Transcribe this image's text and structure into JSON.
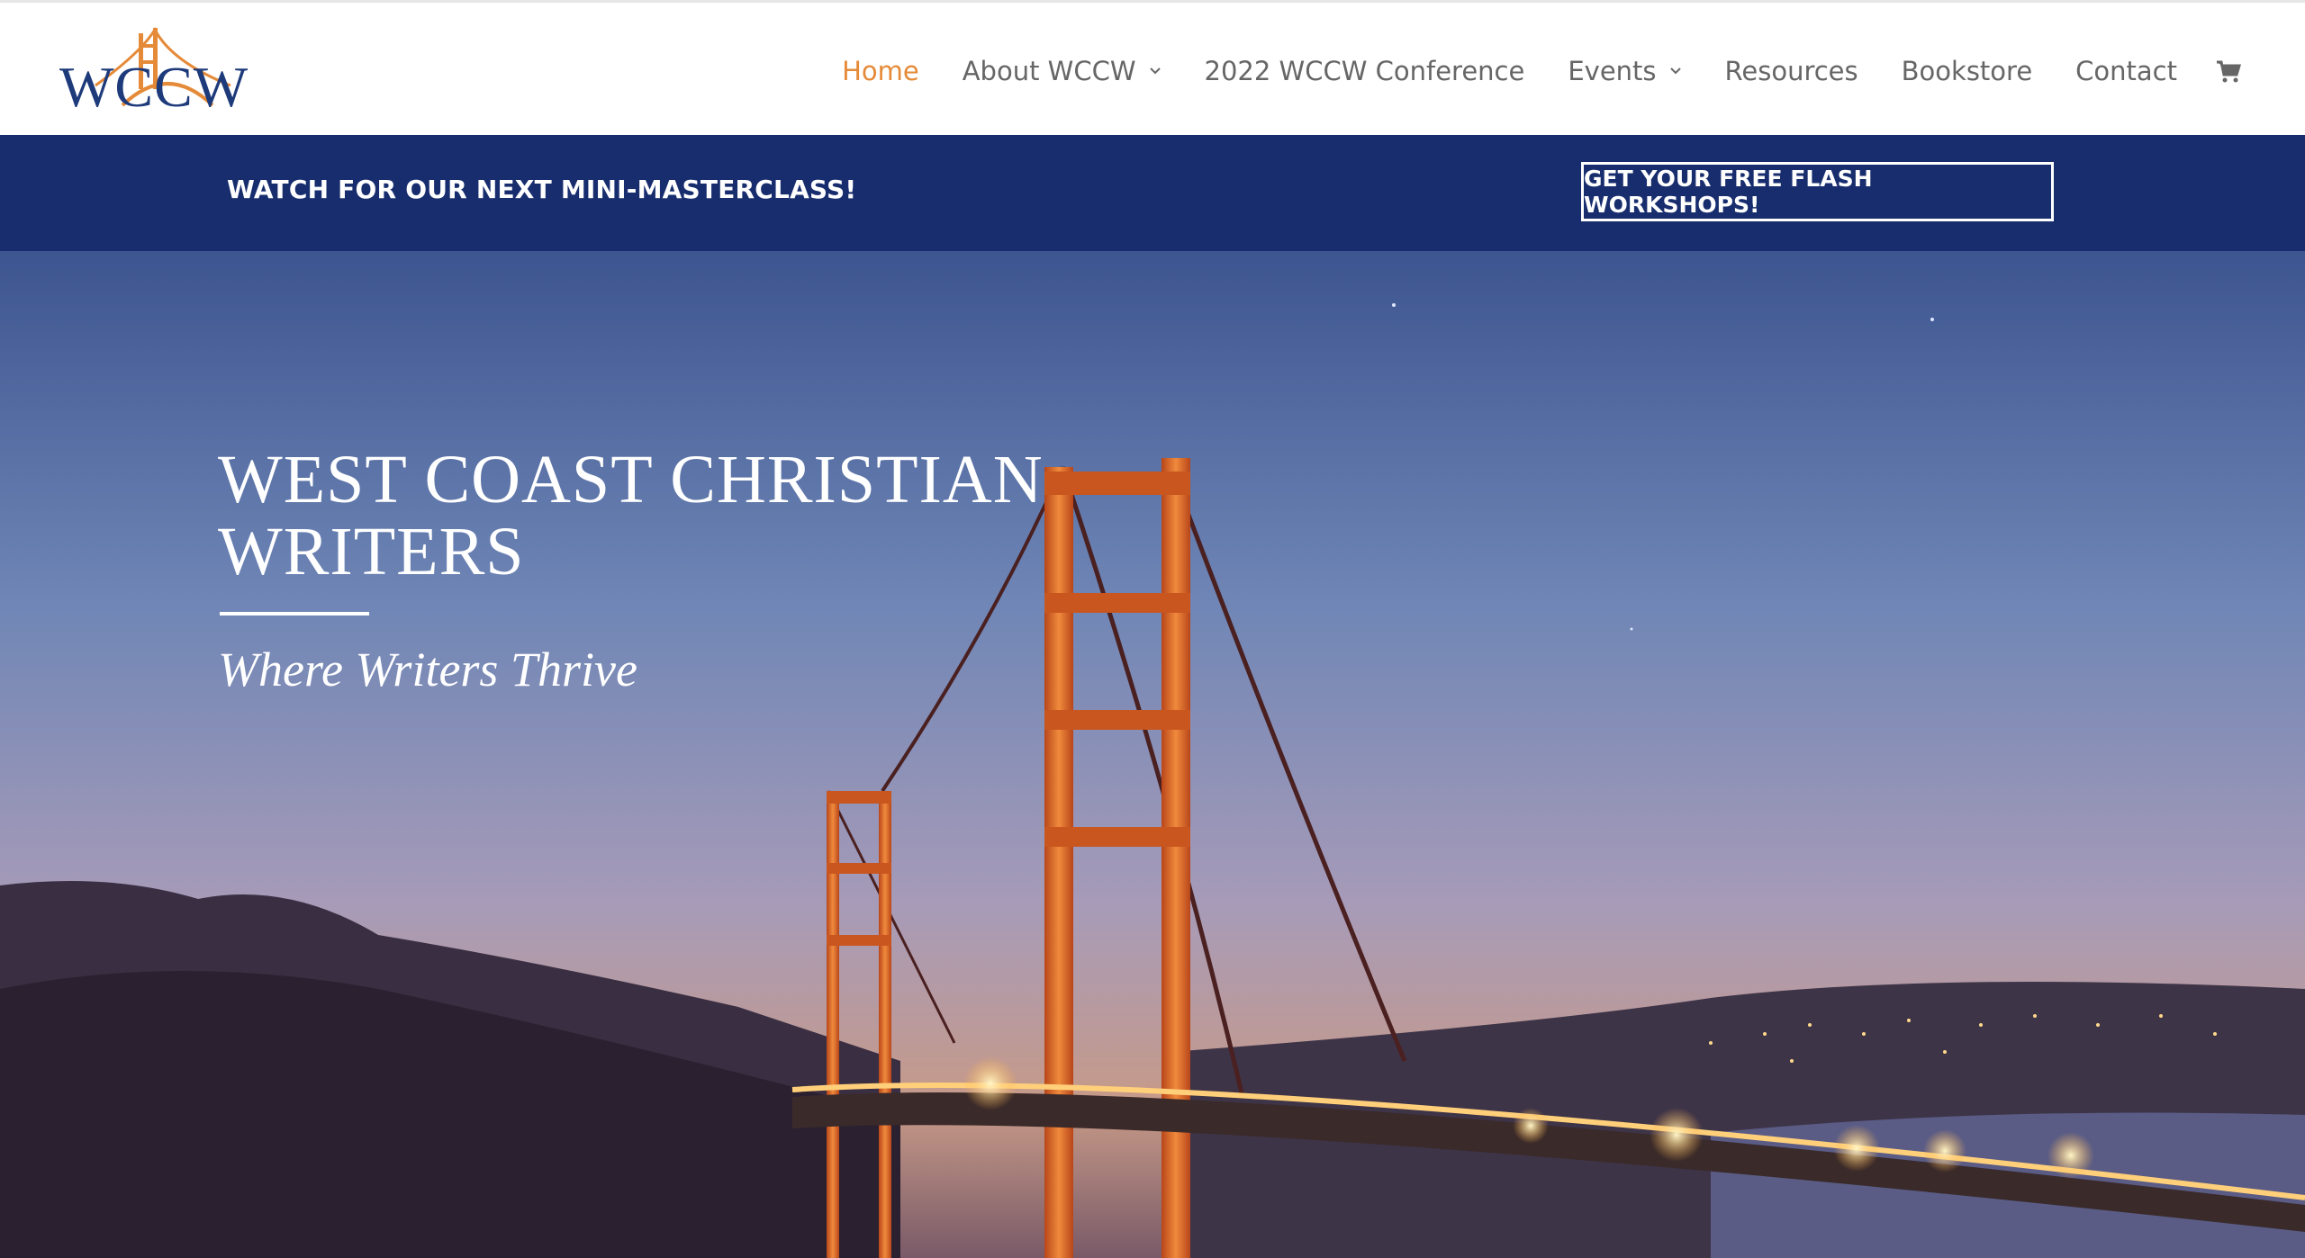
{
  "brand": {
    "logo_text": "WCCW"
  },
  "nav": {
    "items": [
      {
        "label": "Home",
        "active": true,
        "dropdown": false
      },
      {
        "label": "About WCCW",
        "active": false,
        "dropdown": true
      },
      {
        "label": "2022 WCCW Conference",
        "active": false,
        "dropdown": false
      },
      {
        "label": "Events",
        "active": false,
        "dropdown": true
      },
      {
        "label": "Resources",
        "active": false,
        "dropdown": false
      },
      {
        "label": "Bookstore",
        "active": false,
        "dropdown": false
      },
      {
        "label": "Contact",
        "active": false,
        "dropdown": false
      }
    ],
    "cart_icon": "cart-icon"
  },
  "promo": {
    "text": "WATCH FOR OUR NEXT MINI-MASTERCLASS!",
    "button_label": "GET YOUR FREE FLASH WORKSHOPS!"
  },
  "hero": {
    "title": "WEST COAST CHRISTIAN WRITERS",
    "subtitle": "Where Writers Thrive"
  },
  "colors": {
    "accent": "#e58a38",
    "navy": "#172d6e",
    "nav_text": "#666666"
  }
}
